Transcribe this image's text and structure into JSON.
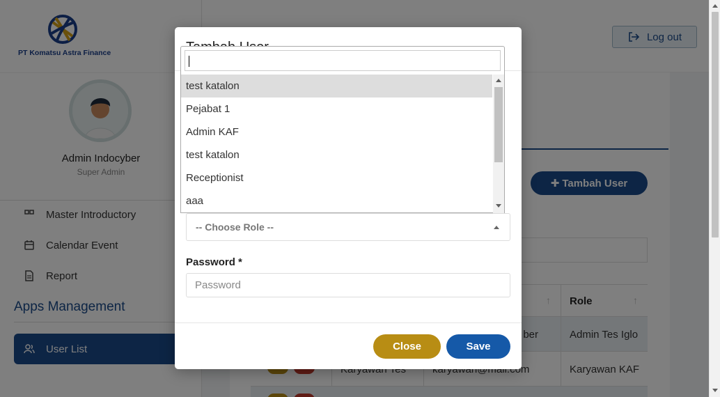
{
  "company": {
    "name": "PT Komatsu Astra Finance"
  },
  "profile": {
    "name": "Admin Indocyber",
    "role": "Super Admin"
  },
  "sidebar": {
    "items": [
      {
        "label": "Master Introductory",
        "icon": "grid-icon"
      },
      {
        "label": "Calendar Event",
        "icon": "calendar-icon"
      },
      {
        "label": "Report",
        "icon": "document-icon"
      }
    ],
    "section_title": "Apps Management",
    "active_item": {
      "label": "User List",
      "icon": "users-icon"
    }
  },
  "header": {
    "logout_label": "Log out"
  },
  "main": {
    "add_button_label": "Tambah User",
    "table": {
      "headers": [
        "Role"
      ],
      "rows": [
        {
          "col2": "Karyawan Tes",
          "col3": "karyawan@mail.com",
          "role": "Karyawan KAF"
        }
      ],
      "row_roles": [
        "Admin Tes Iglo",
        "Karyawan KAF"
      ],
      "partial_texts": [
        "ber"
      ]
    }
  },
  "modal": {
    "title": "Tambah User",
    "role_placeholder": "-- Choose Role --",
    "password_label": "Password *",
    "password_placeholder": "Password",
    "close_label": "Close",
    "save_label": "Save"
  },
  "dropdown": {
    "search_value": "",
    "options": [
      "test katalon",
      "Pejabat 1",
      "Admin KAF",
      "test katalon",
      "Receptionist",
      "aaa"
    ],
    "highlighted_index": 0
  },
  "colors": {
    "primary": "#1a4a8a",
    "close_button": "#b88d14",
    "save_button": "#1559a8"
  }
}
